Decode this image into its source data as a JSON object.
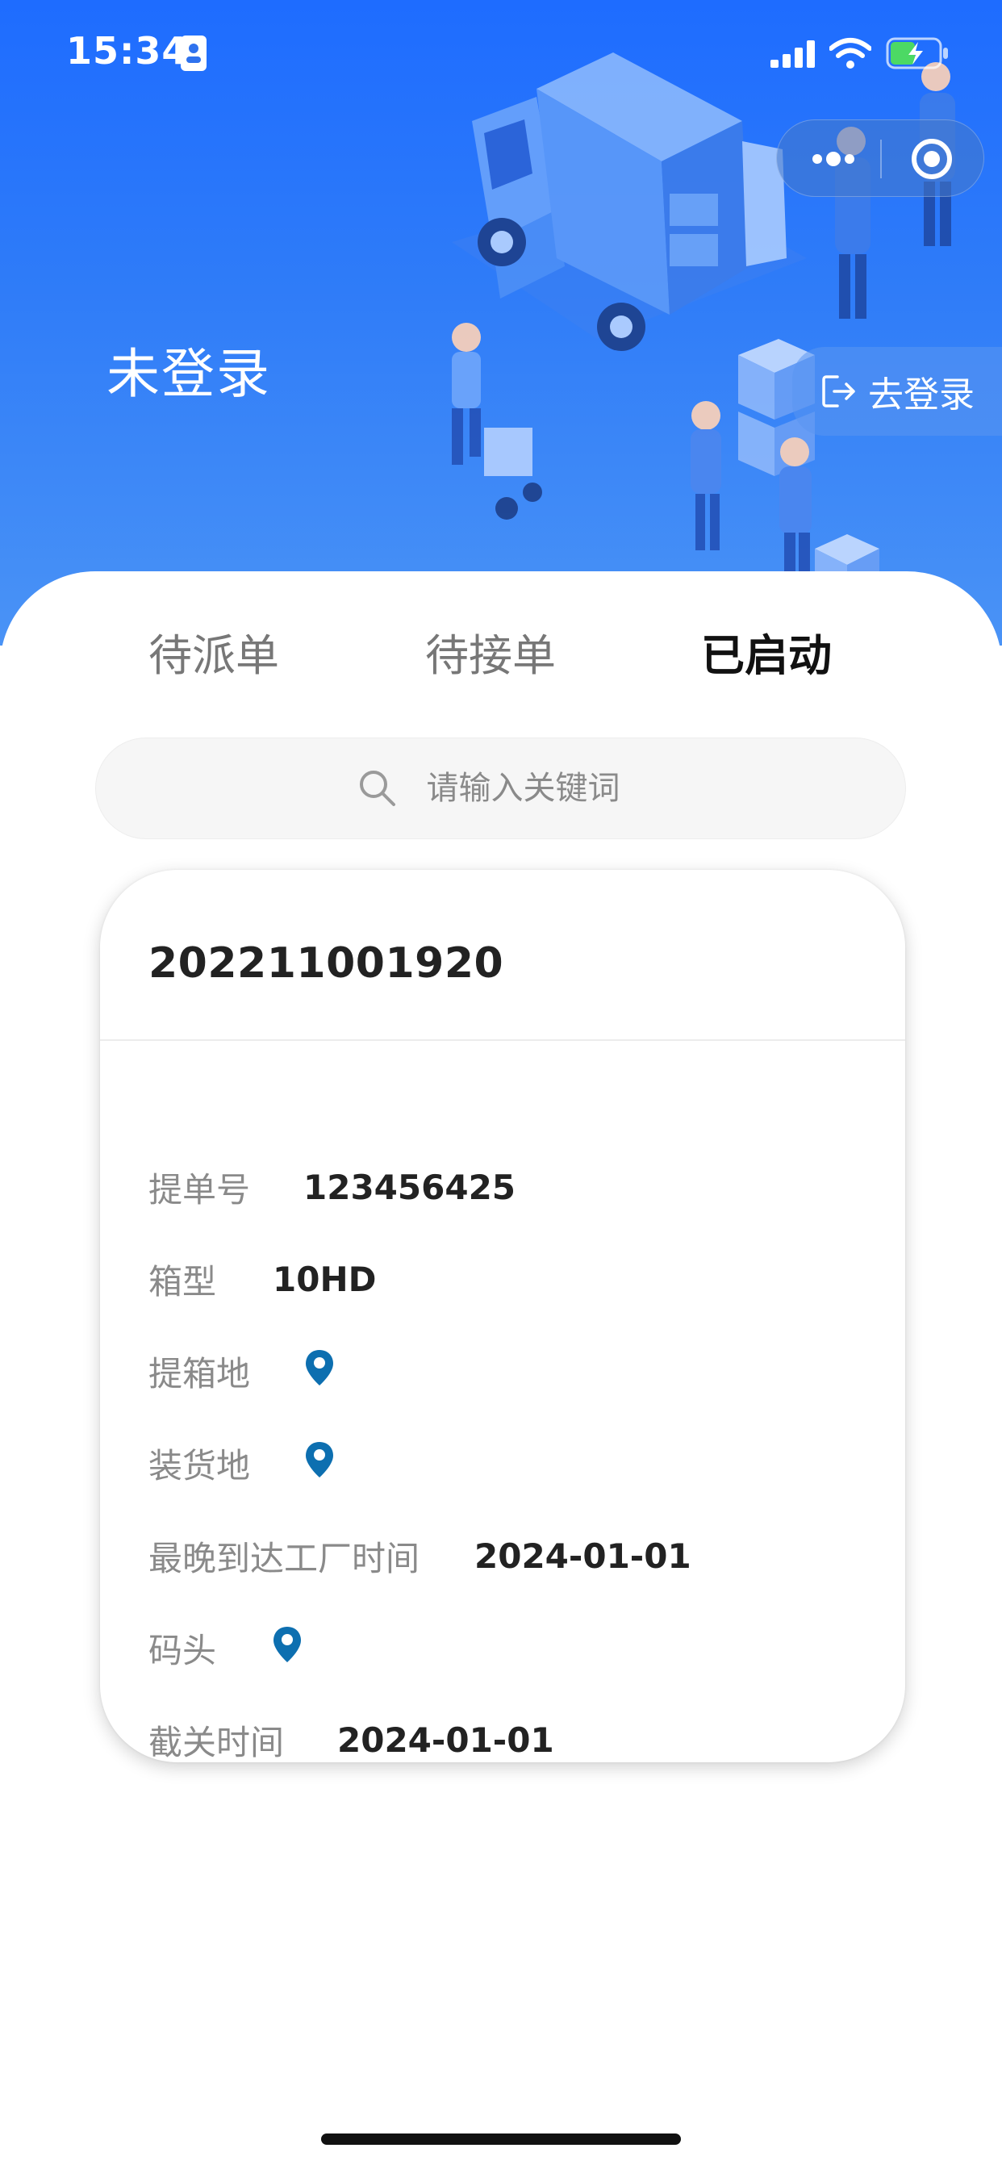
{
  "status_bar": {
    "time": "15:34"
  },
  "header": {
    "title": "未登录",
    "login_button": {
      "label": "去登录",
      "icon": "logout-arrow-icon"
    },
    "capsule": {
      "more_icon": "more-dots-icon",
      "close_icon": "target-circle-icon"
    }
  },
  "tabs": [
    {
      "label": "待派单",
      "active": false
    },
    {
      "label": "待接单",
      "active": false
    },
    {
      "label": "已启动",
      "active": true
    }
  ],
  "search": {
    "placeholder": "请输入关键词",
    "value": ""
  },
  "order": {
    "number": "202211001920",
    "fields": {
      "bill_no_label": "提单号",
      "bill_no_value": "123456425",
      "box_type_label": "箱型",
      "box_type_value": "10HD",
      "pickup_label": "提箱地",
      "loading_label": "装货地",
      "latest_arrival_label": "最晚到达工厂时间",
      "latest_arrival_value": "2024-01-01",
      "dock_label": "码头",
      "cutoff_label": "截关时间",
      "cutoff_value": "2024-01-01"
    }
  },
  "colors": {
    "primary": "#2f7cf0",
    "header_top": "#1e6cff",
    "pin": "#0d6fb0"
  }
}
